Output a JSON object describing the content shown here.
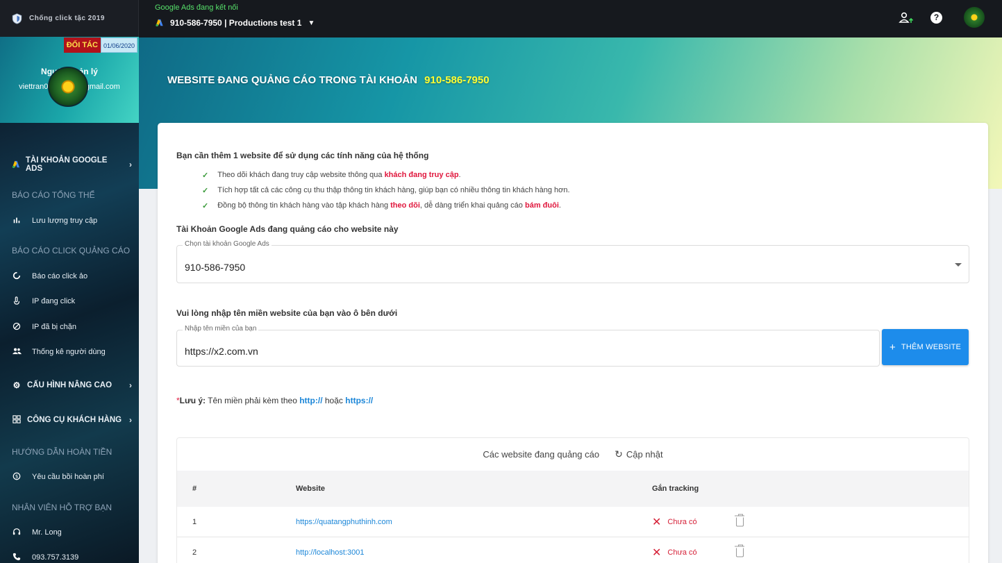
{
  "sidebar": {
    "brand_title": "Chống click tặc 2019",
    "partner_badge": "ĐỐI TÁC",
    "partner_date": "01/06/2020",
    "role": "Người quản lý",
    "email": "viettran040898.vt@gmail.com",
    "google_ads_accounts": "TÀI KHOẢN GOOGLE ADS",
    "sections": {
      "overview": "BÁO CÁO TỔNG THỂ",
      "click_reports": "BÁO CÁO CLICK QUẢNG CÁO",
      "refund_guide": "HƯỚNG DẪN HOÀN TIỀN",
      "support_staff": "NHÂN VIÊN HỖ TRỢ BẠN"
    },
    "items": {
      "traffic": "Lưu lượng truy cập",
      "fake_click_report": "Báo cáo click ảo",
      "ip_clicking": "IP đang click",
      "ip_blocked": "IP đã bị chặn",
      "user_stats": "Thống kê người dùng",
      "advanced_config": "CẤU HÌNH NÂNG CAO",
      "customer_tools": "CÔNG CỤ KHÁCH HÀNG",
      "refund_request": "Yêu cầu bồi hoàn phí",
      "staff_name": "Mr. Long",
      "staff_phone": "093.757.3139"
    }
  },
  "topbar": {
    "status": "Google Ads đang kết nối",
    "account": "910-586-7950 | Productions test 1"
  },
  "hero": {
    "title": "WEBSITE ĐANG QUẢNG CÁO TRONG TÀI KHOẢN",
    "account_id": "910-586-7950"
  },
  "content": {
    "intro": "Bạn cần thêm 1 website để sử dụng các tính năng của hệ thống",
    "bullets": [
      {
        "before": "Theo dõi khách đang truy cập website thông qua ",
        "em1": "khách đang truy cập",
        "mid": ".",
        "em2": "",
        "after": ""
      },
      {
        "before": "Tích hợp tất cả các công cụ thu thập thông tin khách hàng, giúp bạn có nhiều thông tin khách hàng hơn.",
        "em1": "",
        "mid": "",
        "em2": "",
        "after": ""
      },
      {
        "before": "Đồng bộ thông tin khách hàng vào tập khách hàng ",
        "em1": "theo dõi",
        "mid": ", dễ dàng triển khai quảng cáo ",
        "em2": "bám đuôi",
        "after": "."
      }
    ],
    "account_section_title": "Tài Khoản Google Ads đang quảng cáo cho website này",
    "account_select_label": "Chọn tài khoản Google Ads",
    "account_select_value": "910-586-7950",
    "domain_section_title": "Vui lòng nhập tên miền website của bạn vào ô bên dưới",
    "domain_label": "Nhập tên miền của bạn",
    "domain_value": "https://x2.com.vn",
    "add_button": "THÊM WEBSITE",
    "note_star": "*",
    "note_label": "Lưu ý:",
    "note_text": " Tên miền phải kèm theo ",
    "note_http": "http://",
    "note_or": " hoặc ",
    "note_https": "https://"
  },
  "table": {
    "caption": "Các website đang quảng cáo",
    "refresh": "Cập nhật",
    "headers": {
      "num": "#",
      "website": "Website",
      "tracking": "Gắn tracking"
    },
    "rows": [
      {
        "num": "1",
        "website": "https://quatangphuthinh.com",
        "tracking": "Chưa có"
      },
      {
        "num": "2",
        "website": "http://localhost:3001",
        "tracking": "Chưa có"
      }
    ]
  },
  "colors": {
    "accent_blue": "#1d8ceb",
    "highlight_red": "#e0173d",
    "status_green": "#56e06a",
    "hero_highlight": "#ffff33"
  },
  "icons": {
    "brand": "shield-icon",
    "google_ads": "google-ads-icon",
    "traffic": "bar-chart-icon",
    "fake_click": "spinner-icon",
    "ip_clicking": "touch-icon",
    "ip_blocked": "block-icon",
    "user_stats": "users-icon",
    "advanced_config": "gear-icon",
    "customer_tools": "grid-icon",
    "refund": "dollar-circle-icon",
    "staff": "headset-icon",
    "phone": "phone-icon",
    "user_upgrade": "user-upgrade-icon",
    "help": "help-icon",
    "refresh": "refresh-icon",
    "not_tracked": "close-icon",
    "delete": "trash-icon",
    "check": "check-icon"
  }
}
